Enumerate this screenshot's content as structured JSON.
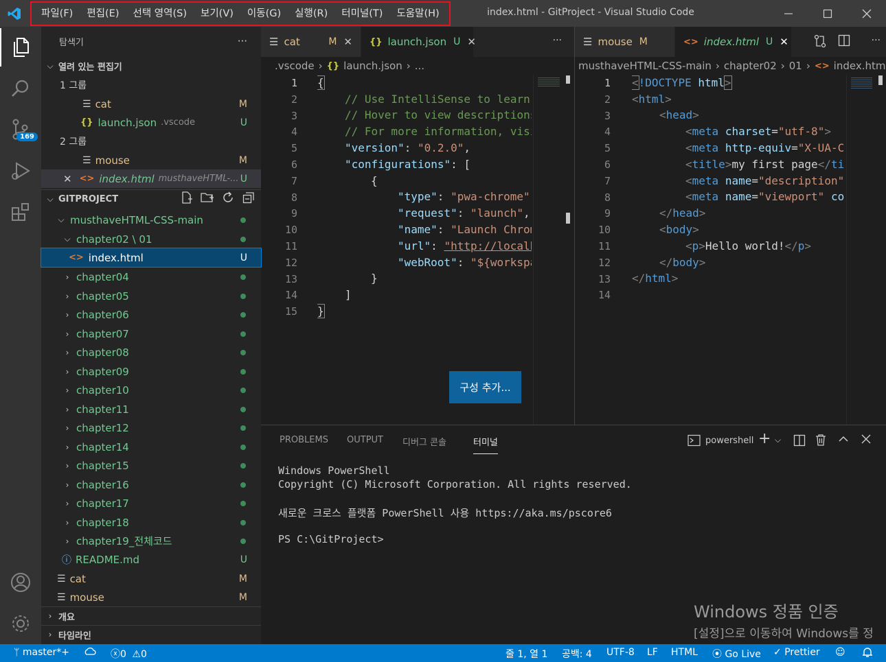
{
  "window": {
    "title": "index.html - GitProject - Visual Studio Code",
    "menu": [
      "파일(F)",
      "편집(E)",
      "선택 영역(S)",
      "보기(V)",
      "이동(G)",
      "실행(R)",
      "터미널(T)",
      "도움말(H)"
    ]
  },
  "activity": {
    "scm_badge": "169"
  },
  "sidebar": {
    "title": "탐색기",
    "more": "···",
    "open_editors": {
      "header": "열려 있는 편집기",
      "group1_label": "1 그룹",
      "group2_label": "2 그룹",
      "items": [
        {
          "name": "cat",
          "status": "M"
        },
        {
          "name": "launch.json",
          "desc": ".vscode",
          "status": "U"
        },
        {
          "name": "mouse",
          "status": "M"
        },
        {
          "name": "index.html",
          "desc": "musthaveHTML-...",
          "status": "U"
        }
      ]
    },
    "project": {
      "header": "GITPROJECT",
      "root": "musthaveHTML-CSS-main",
      "chapter02": "chapter02 \\ 01",
      "index": "index.html",
      "index_status": "U",
      "chapters": [
        "chapter04",
        "chapter05",
        "chapter06",
        "chapter07",
        "chapter08",
        "chapter09",
        "chapter10",
        "chapter11",
        "chapter12",
        "chapter14",
        "chapter15",
        "chapter16",
        "chapter17",
        "chapter18",
        "chapter19_전체코드"
      ],
      "readme": "README.md",
      "readme_status": "U",
      "cat": "cat",
      "cat_status": "M",
      "mouse": "mouse",
      "mouse_status": "M"
    },
    "outline": "개요",
    "timeline": "타임라인"
  },
  "editor_left": {
    "tabs": [
      {
        "name": "cat",
        "status": "M"
      },
      {
        "name": "launch.json",
        "status": "U"
      }
    ],
    "more": "···",
    "breadcrumb": [
      ".vscode",
      "launch.json",
      "..."
    ],
    "line_numbers": [
      "1",
      "2",
      "3",
      "4",
      "5",
      "6",
      "7",
      "8",
      "9",
      "10",
      "11",
      "12",
      "13",
      "14",
      "15"
    ],
    "add_config_button": "구성 추가..."
  },
  "editor_right": {
    "tabs": [
      {
        "name": "mouse",
        "status": "M"
      },
      {
        "name": "index.html",
        "status": "U"
      }
    ],
    "more": "···",
    "breadcrumb": [
      "musthaveHTML-CSS-main",
      "chapter02",
      "01",
      "index.html"
    ],
    "line_numbers": [
      "1",
      "2",
      "3",
      "4",
      "5",
      "6",
      "7",
      "8",
      "9",
      "10",
      "11",
      "12",
      "13",
      "14"
    ]
  },
  "panel": {
    "tabs": [
      "PROBLEMS",
      "OUTPUT",
      "디버그 콘솔",
      "터미널"
    ],
    "shell": "powershell",
    "terminal_lines": [
      "Windows PowerShell",
      "Copyright (C) Microsoft Corporation. All rights reserved.",
      "새로운 크로스 플랫폼 PowerShell 사용 https://aka.ms/pscore6",
      "PS C:\\GitProject>"
    ]
  },
  "activation": {
    "line1": "Windows 정품 인증",
    "line2": "[설정]으로 이동하여 Windows를 정"
  },
  "statusbar": {
    "branch": "master*+",
    "errors": "0",
    "warnings": "0",
    "position": "줄 1, 열 1",
    "spaces": "공백: 4",
    "encoding": "UTF-8",
    "eol": "LF",
    "language": "HTML",
    "golive": "Go Live",
    "prettier": "Prettier"
  },
  "colors": {
    "accent": "#007acc",
    "highlight_border": "#e81123",
    "untracked": "#73c991",
    "modified": "#e2c08d"
  }
}
